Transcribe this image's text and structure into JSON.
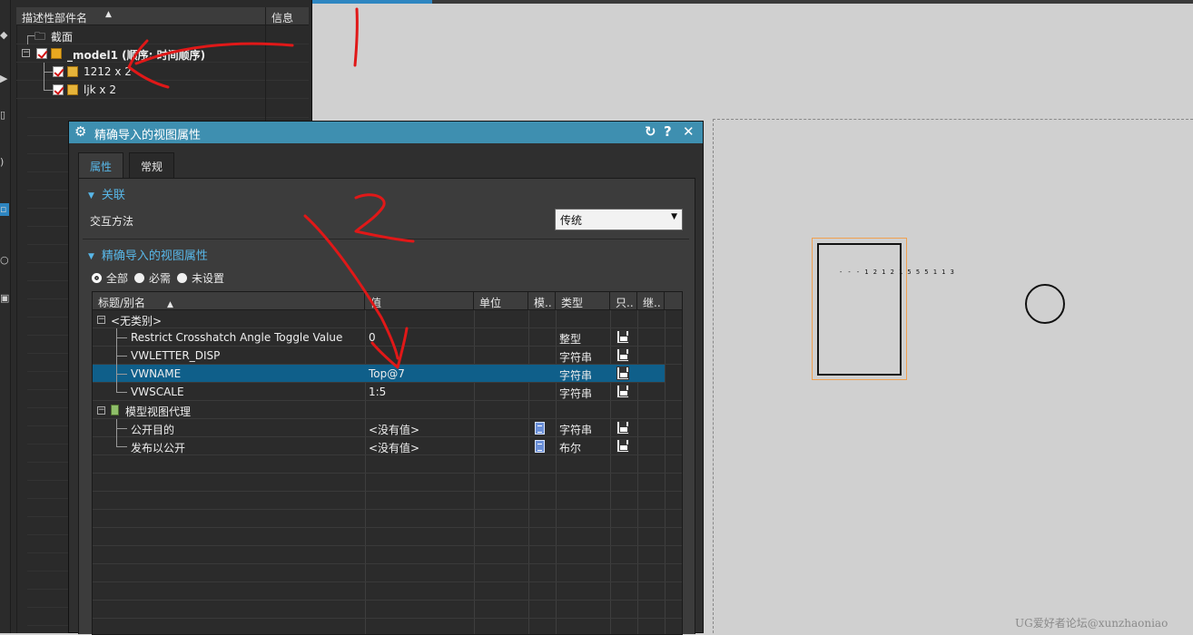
{
  "navigator": {
    "header_col1": "描述性部件名",
    "header_col2": "信息",
    "items": [
      {
        "label": "截面"
      },
      {
        "label": "_model1 (顺序: 时间顺序)"
      },
      {
        "label": "1212 x 2"
      },
      {
        "label": "ljk x 2"
      }
    ]
  },
  "dialog": {
    "title": "精确导入的视图属性",
    "tabs": [
      "属性",
      "常规"
    ],
    "section_link": "关联",
    "interaction_label": "交互方法",
    "interaction_value": "传统",
    "section_props": "精确导入的视图属性",
    "filters": [
      "全部",
      "必需",
      "未设置"
    ],
    "columns": [
      "标题/别名",
      "值",
      "单位",
      "模..",
      "类型",
      "只..",
      "继.."
    ],
    "groups": [
      {
        "label": "<无类别>"
      },
      {
        "label": "模型视图代理"
      }
    ],
    "rows": [
      {
        "title": "Restrict Crosshatch Angle Toggle Value",
        "value": "0",
        "type": "整型"
      },
      {
        "title": "VWLETTER_DISP",
        "value": "",
        "type": "字符串"
      },
      {
        "title": "VWNAME",
        "value": "Top@7",
        "type": "字符串"
      },
      {
        "title": "VWSCALE",
        "value": "1:5",
        "type": "字符串"
      },
      {
        "title": "公开目的",
        "value": "<没有值>",
        "type": "字符串"
      },
      {
        "title": "发布以公开",
        "value": "<没有值>",
        "type": "布尔"
      }
    ]
  },
  "drawing": {
    "view_text": "- - - 1 2 1 2 1 5 5 5 1 1 3"
  },
  "watermark": "UG爱好者论坛@xunzhaoniao",
  "colors": {
    "accent": "#3e8fb0",
    "selection": "#0f5f8a",
    "annotation": "#e01818"
  }
}
